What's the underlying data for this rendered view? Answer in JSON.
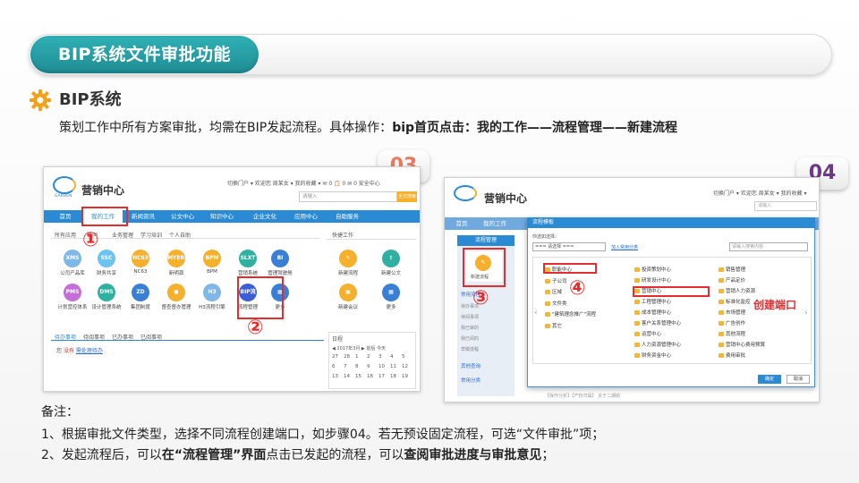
{
  "header": {
    "title": "BIP系统文件审批功能",
    "section_title": "BIP系统",
    "description_plain": "策划工作中所有方案审批，均需在BIP发起流程。具体操作：",
    "description_bold": "bip首页点击：我的工作——流程管理——新建流程"
  },
  "steps": {
    "step3_badge": "03",
    "step4_badge": "04",
    "circle_1": "①",
    "circle_2": "②",
    "circle_3": "③",
    "circle_4": "④",
    "create_port_label": "创建端口"
  },
  "left_screen": {
    "app_name": "营销中心",
    "logo_sub": "GARDEN",
    "top_links": "切换门户 ▾  欢迎您 周某女 ▾  我的收藏 ▾  ✉ 0  📋 0  ✉ 0  安全中心",
    "search_placeholder": "请输入",
    "search_button": "全文搜索",
    "nav": [
      "首页",
      "我的工作",
      "新闻资讯",
      "公文中心",
      "知识中心",
      "企业文化",
      "应用中心",
      "自助服务"
    ],
    "app_tabs": [
      "所有应用",
      "协同",
      "业务管理",
      "学习培训",
      "个人自助"
    ],
    "quick_title": "快捷工作",
    "apps": [
      {
        "abbr": "XMS",
        "label": "公司产品库",
        "color": "#7fb7e8"
      },
      {
        "abbr": "SSC",
        "label": "财务共享",
        "color": "#6cc3f0"
      },
      {
        "abbr": "NC63",
        "label": "NC63",
        "color": "#f5b02e"
      },
      {
        "abbr": "MYERP",
        "label": "新明源",
        "color": "#f5b02e"
      },
      {
        "abbr": "BPM",
        "label": "BPM",
        "color": "#f5b02e"
      },
      {
        "abbr": "SLXT",
        "label": "营销系统",
        "color": "#2fb0a0"
      },
      {
        "abbr": "BI",
        "label": "管理驾驶舱",
        "color": "#3a7fd6"
      },
      {
        "abbr": "PMS",
        "label": "计划营控体系",
        "color": "#c46fd8"
      },
      {
        "abbr": "DMS",
        "label": "设计管理系统",
        "color": "#2fb0a0"
      },
      {
        "abbr": "ZD",
        "label": "集团制度",
        "color": "#3a7fd6"
      },
      {
        "abbr": "●",
        "label": "督查督办管理",
        "color": "#f5b02e"
      },
      {
        "abbr": "H3",
        "label": "H3流程引擎",
        "color": "#7fb7e8"
      },
      {
        "abbr": "BIP流程",
        "label": "流程管理",
        "color": "#3a5fd6"
      },
      {
        "abbr": "▦",
        "label": "更多",
        "color": "#3a7fd6"
      }
    ],
    "quick_apps": [
      {
        "label": "新建流程",
        "color": "#f5b02e",
        "abbr": "✎"
      },
      {
        "label": "新建公文",
        "color": "#2fb0a0",
        "abbr": "⇪"
      },
      {
        "label": "新建会议",
        "color": "#f5b02e",
        "abbr": "▣"
      },
      {
        "label": "更多",
        "color": "#3a7fd6",
        "abbr": "▦"
      }
    ],
    "task_tabs": [
      "待办事项",
      "待阅事项",
      "已办事项",
      "已阅事项"
    ],
    "task_line_prefix": "您",
    "task_line_red": "没有",
    "task_line_link": "需处理待办",
    "calendar_title": "日程",
    "calendar_header": "◀ 2017年3月 ▶   前后   今天",
    "calendar_row1": [
      "27",
      "28",
      "1",
      "2",
      "3",
      "4",
      "5"
    ],
    "calendar_row2": [
      "6",
      "7",
      "8",
      "9",
      "10",
      "11",
      "12"
    ],
    "calendar_row3": [
      "13",
      "14",
      "15",
      "16",
      "17",
      "18",
      "19"
    ]
  },
  "right_screen": {
    "app_name": "营销中心",
    "top_links": "切换门户 ▾  欢迎您 周某女 ▾  我的收藏 ▾",
    "search_placeholder": "请输入",
    "nav": [
      "首页",
      "我的工作"
    ],
    "side_section": "流程管理",
    "side_button": "新建流程",
    "side_menu": [
      "常用流程",
      "待办事项",
      "待阅事项",
      "我已审的",
      "我已阅的",
      "草稿流程"
    ],
    "side_groups": [
      "其他查询",
      "常用分类"
    ],
    "dialog_title": "流程模板",
    "dialog_hint": "你选如选择：",
    "select_value": "=== 请选择 ===",
    "add_common": "加入常用分类",
    "search_placeholder2": "请输入搜索内容",
    "col1": [
      "职能中心",
      "子公司",
      "区域",
      "文件类",
      "\"建筑理念推广\"流程",
      "其它"
    ],
    "col2": [
      "投资策划中心",
      "研发设计中心",
      "营销中心",
      "工程管理中心",
      "成本管理中心",
      "客户关系管理中心",
      "运营中心",
      "人力资源管理中心",
      "财务资金中心"
    ],
    "col3": [
      "销售管理",
      "产品定价",
      "营销人力资源",
      "标准化监控",
      "市场管理",
      "广告创作",
      "其他流程",
      "营销中心费用预算",
      "费用审批"
    ],
    "confirm": "确定",
    "cancel": "取消",
    "footer": "【操作分析】【产权归属】 关于二期航"
  },
  "notes": {
    "heading": "备注：",
    "line1": "1、根据审批文件类型，选择不同流程创建端口，如步骤04。若无预设固定流程，可选“文件审批”项；",
    "line2_a": "2、发起流程后，可以",
    "line2_b": "在“流程管理”界面",
    "line2_c": "点击已发起的流程，可以",
    "line2_d": "查阅审批进度与审批意见",
    "line2_e": "；"
  }
}
